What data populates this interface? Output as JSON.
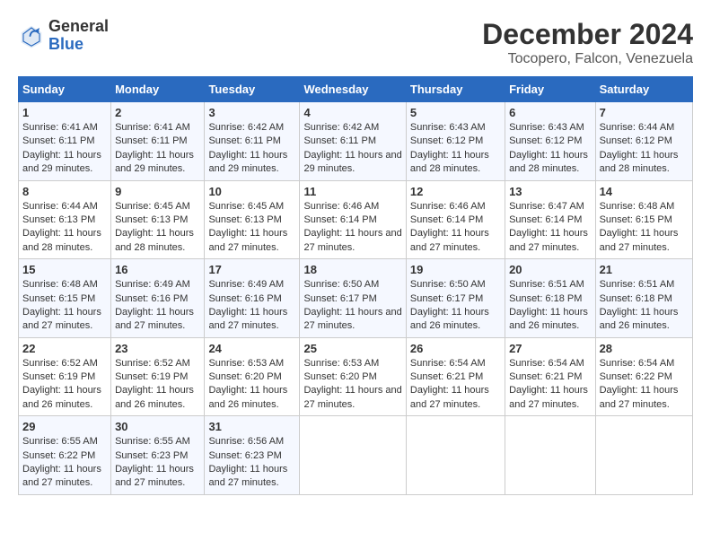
{
  "header": {
    "logo_general": "General",
    "logo_blue": "Blue",
    "main_title": "December 2024",
    "subtitle": "Tocopero, Falcon, Venezuela"
  },
  "calendar": {
    "days_of_week": [
      "Sunday",
      "Monday",
      "Tuesday",
      "Wednesday",
      "Thursday",
      "Friday",
      "Saturday"
    ],
    "weeks": [
      [
        {
          "day": "1",
          "sunrise": "6:41 AM",
          "sunset": "6:11 PM",
          "daylight": "11 hours and 29 minutes."
        },
        {
          "day": "2",
          "sunrise": "6:41 AM",
          "sunset": "6:11 PM",
          "daylight": "11 hours and 29 minutes."
        },
        {
          "day": "3",
          "sunrise": "6:42 AM",
          "sunset": "6:11 PM",
          "daylight": "11 hours and 29 minutes."
        },
        {
          "day": "4",
          "sunrise": "6:42 AM",
          "sunset": "6:11 PM",
          "daylight": "11 hours and 29 minutes."
        },
        {
          "day": "5",
          "sunrise": "6:43 AM",
          "sunset": "6:12 PM",
          "daylight": "11 hours and 28 minutes."
        },
        {
          "day": "6",
          "sunrise": "6:43 AM",
          "sunset": "6:12 PM",
          "daylight": "11 hours and 28 minutes."
        },
        {
          "day": "7",
          "sunrise": "6:44 AM",
          "sunset": "6:12 PM",
          "daylight": "11 hours and 28 minutes."
        }
      ],
      [
        {
          "day": "8",
          "sunrise": "6:44 AM",
          "sunset": "6:13 PM",
          "daylight": "11 hours and 28 minutes."
        },
        {
          "day": "9",
          "sunrise": "6:45 AM",
          "sunset": "6:13 PM",
          "daylight": "11 hours and 28 minutes."
        },
        {
          "day": "10",
          "sunrise": "6:45 AM",
          "sunset": "6:13 PM",
          "daylight": "11 hours and 27 minutes."
        },
        {
          "day": "11",
          "sunrise": "6:46 AM",
          "sunset": "6:14 PM",
          "daylight": "11 hours and 27 minutes."
        },
        {
          "day": "12",
          "sunrise": "6:46 AM",
          "sunset": "6:14 PM",
          "daylight": "11 hours and 27 minutes."
        },
        {
          "day": "13",
          "sunrise": "6:47 AM",
          "sunset": "6:14 PM",
          "daylight": "11 hours and 27 minutes."
        },
        {
          "day": "14",
          "sunrise": "6:48 AM",
          "sunset": "6:15 PM",
          "daylight": "11 hours and 27 minutes."
        }
      ],
      [
        {
          "day": "15",
          "sunrise": "6:48 AM",
          "sunset": "6:15 PM",
          "daylight": "11 hours and 27 minutes."
        },
        {
          "day": "16",
          "sunrise": "6:49 AM",
          "sunset": "6:16 PM",
          "daylight": "11 hours and 27 minutes."
        },
        {
          "day": "17",
          "sunrise": "6:49 AM",
          "sunset": "6:16 PM",
          "daylight": "11 hours and 27 minutes."
        },
        {
          "day": "18",
          "sunrise": "6:50 AM",
          "sunset": "6:17 PM",
          "daylight": "11 hours and 27 minutes."
        },
        {
          "day": "19",
          "sunrise": "6:50 AM",
          "sunset": "6:17 PM",
          "daylight": "11 hours and 26 minutes."
        },
        {
          "day": "20",
          "sunrise": "6:51 AM",
          "sunset": "6:18 PM",
          "daylight": "11 hours and 26 minutes."
        },
        {
          "day": "21",
          "sunrise": "6:51 AM",
          "sunset": "6:18 PM",
          "daylight": "11 hours and 26 minutes."
        }
      ],
      [
        {
          "day": "22",
          "sunrise": "6:52 AM",
          "sunset": "6:19 PM",
          "daylight": "11 hours and 26 minutes."
        },
        {
          "day": "23",
          "sunrise": "6:52 AM",
          "sunset": "6:19 PM",
          "daylight": "11 hours and 26 minutes."
        },
        {
          "day": "24",
          "sunrise": "6:53 AM",
          "sunset": "6:20 PM",
          "daylight": "11 hours and 26 minutes."
        },
        {
          "day": "25",
          "sunrise": "6:53 AM",
          "sunset": "6:20 PM",
          "daylight": "11 hours and 27 minutes."
        },
        {
          "day": "26",
          "sunrise": "6:54 AM",
          "sunset": "6:21 PM",
          "daylight": "11 hours and 27 minutes."
        },
        {
          "day": "27",
          "sunrise": "6:54 AM",
          "sunset": "6:21 PM",
          "daylight": "11 hours and 27 minutes."
        },
        {
          "day": "28",
          "sunrise": "6:54 AM",
          "sunset": "6:22 PM",
          "daylight": "11 hours and 27 minutes."
        }
      ],
      [
        {
          "day": "29",
          "sunrise": "6:55 AM",
          "sunset": "6:22 PM",
          "daylight": "11 hours and 27 minutes."
        },
        {
          "day": "30",
          "sunrise": "6:55 AM",
          "sunset": "6:23 PM",
          "daylight": "11 hours and 27 minutes."
        },
        {
          "day": "31",
          "sunrise": "6:56 AM",
          "sunset": "6:23 PM",
          "daylight": "11 hours and 27 minutes."
        },
        null,
        null,
        null,
        null
      ]
    ]
  }
}
